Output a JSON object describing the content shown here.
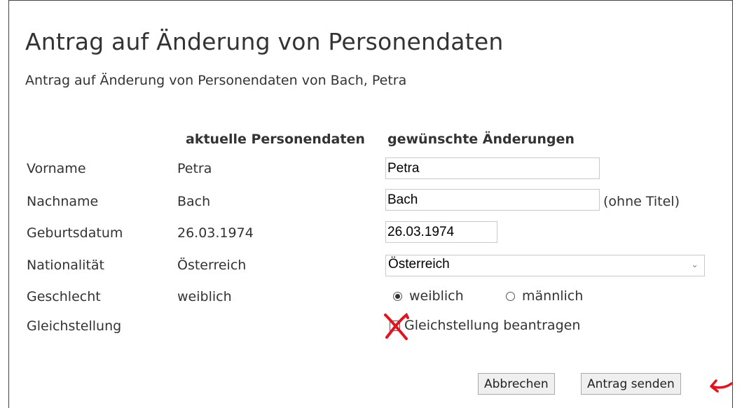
{
  "title": "Antrag auf Änderung von Personendaten",
  "subtitle": "Antrag auf Änderung von Personendaten von Bach, Petra",
  "columns": {
    "current": "aktuelle Personendaten",
    "requested": "gewünschte Änderungen"
  },
  "rows": {
    "vorname": {
      "label": "Vorname",
      "current": "Petra",
      "value": "Petra"
    },
    "nachname": {
      "label": "Nachname",
      "current": "Bach",
      "value": "Bach",
      "hint": "(ohne Titel)"
    },
    "geburtsdatum": {
      "label": "Geburtsdatum",
      "current": "26.03.1974",
      "value": "26.03.1974"
    },
    "nationalitaet": {
      "label": "Nationalität",
      "current": "Österreich",
      "value": "Österreich"
    },
    "geschlecht": {
      "label": "Geschlecht",
      "current": "weiblich",
      "option_female": "weiblich",
      "option_male": "männlich",
      "selected": "weiblich"
    },
    "gleichstellung": {
      "label": "Gleichstellung",
      "checkbox_label": "Gleichstellung beantragen",
      "checked": false
    }
  },
  "buttons": {
    "cancel": "Abbrechen",
    "submit": "Antrag senden"
  },
  "annotation_color": "#e8101a"
}
